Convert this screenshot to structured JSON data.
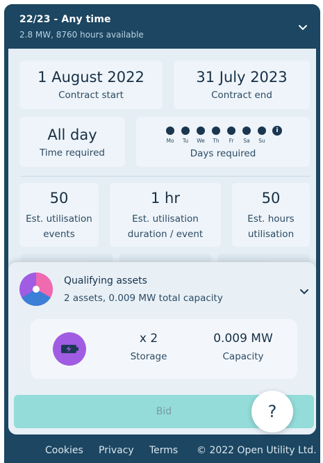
{
  "header": {
    "title": "22/23 - Any time",
    "subtitle": "2.8 MW, 8760 hours available"
  },
  "contract": {
    "start_value": "1 August 2022",
    "start_label": "Contract start",
    "end_value": "31 July 2023",
    "end_label": "Contract end"
  },
  "time": {
    "value": "All day",
    "label": "Time required"
  },
  "days": {
    "items": [
      "Mo",
      "Tu",
      "We",
      "Th",
      "Fr",
      "Sa",
      "Su"
    ],
    "label": "Days required",
    "info_icon": "i"
  },
  "estimates": {
    "events_value": "50",
    "events_label": "Est. utilisation events",
    "duration_value": "1 hr",
    "duration_label": "Est. utilisation duration / event",
    "hours_value": "50",
    "hours_label": "Est. hours utilisation"
  },
  "assets": {
    "title": "Qualifying assets",
    "subtitle": "2 assets, 0.009 MW total capacity",
    "item": {
      "count": "x 2",
      "type": "Storage",
      "capacity_value": "0.009 MW",
      "capacity_label": "Capacity",
      "icon": "battery-icon",
      "icon_color": "#a05ce2"
    },
    "pie_colors": [
      "#f06ab0",
      "#3b7fd6",
      "#a05ce2"
    ]
  },
  "bid_label": "Bid",
  "help_label": "?",
  "footer": {
    "cookies": "Cookies",
    "privacy": "Privacy",
    "terms": "Terms",
    "copyright": "© 2022 Open Utility Ltd."
  },
  "colors": {
    "header_bg": "#1c4661",
    "content_bg": "#e5eef5",
    "bid_bg": "#93dcd9"
  }
}
